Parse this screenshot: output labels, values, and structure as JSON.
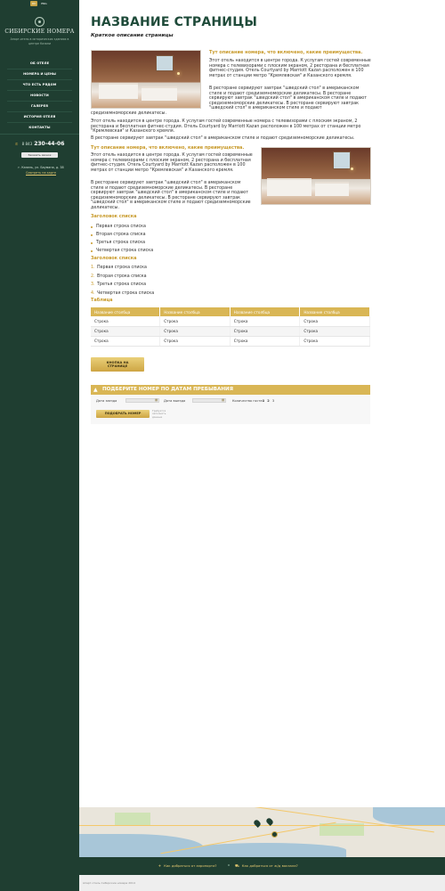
{
  "sidebar": {
    "lang": [
      "RU",
      "ENG"
    ],
    "logo_name": "СИБИРСКИЕ НОМЕРА",
    "logo_tagline": "Апарт-отель в исторических зданиях в центре Казани",
    "nav": [
      "ОБ ОТЕЛЕ",
      "НОМЕРА И ЦЕНЫ",
      "ЧТО ЕСТЬ РЯДОМ",
      "НОВОСТИ",
      "ГАЛЕРЕЯ",
      "ИСТОРИЯ ОТЕЛЯ",
      "КОНТАКТЫ"
    ],
    "phone_code": "8 843",
    "phone_number": "230-44-06",
    "callback": "Заказать звонок",
    "address": "г. Казань, ул. Баумана, д. 38",
    "map_link": "Смотреть на карте"
  },
  "main": {
    "title": "НАЗВАНИЕ СТРАНИЦЫ",
    "subtitle": "Краткое описание страницы",
    "lead1": "Тут описание номера, что включено, какие преимущества.",
    "p1": "Этот отель находится в центре города. К услугам гостей современные номера с телевизорами с плоским экраном, 2 ресторана и бесплатная фитнес-студия. Отель Courtyard by Marriott Kazan расположен в 100 метрах от станции метро \"Кремлевская\" и Казанского кремля.",
    "p2": "В ресторане сервируют завтрак \"шведский стол\" в американском стиле и подают средиземноморские деликатесы. В ресторане сервируют завтрак \"шведский стол\" в американском стиле и подают средиземноморские деликатесы. В ресторане сервируют завтрак \"шведский стол\" в американском стиле и подают",
    "p2_tail": "средиземноморские деликатесы.",
    "p3": "Этот отель находится в центре города. К услугам гостей современные номера с телевизорами с плоским экраном, 2 ресторана и бесплатная фитнес-студия. Отель Courtyard by Marriott Kazan расположен в 100 метрах от станции метро \"Кремлевская\" и Казанского кремля.",
    "p4": "В ресторане сервируют завтрак \"шведский стол\" в американском стиле и подают средиземноморские деликатесы.",
    "lead2": "Тут описание номера, что включено, какие преимущества.",
    "p5": "Этот отель находится в центре города. К услугам гостей современные номера с телевизорами с плоским экраном, 2 ресторана и бесплатная фитнес-студия. Отель Courtyard by Marriott Kazan расположен в 100 метрах от станции метро \"Кремлевская\" и Казанского кремля.",
    "p6": "В ресторане сервируют завтрак \"шведский стол\" в американском стиле и подают средиземноморские деликатесы. В ресторане сервируют завтрак \"шведский стол\" в американском стиле и подают средиземноморские деликатесы. В ресторане сервируют завтрак \"шведский стол\" в американском стиле и подают средиземноморские деликатесы.",
    "ul_head": "Заголовок списка",
    "ul": [
      "Первая строка списка",
      "Вторая строка списка",
      "Третья строка списка",
      "Четвертая строка списка"
    ],
    "ol_head": "Заголовок списка",
    "ol": [
      "Первая строка списка",
      "Вторая строка списка",
      "Третья строка списка",
      "Четвертая строка списка"
    ],
    "table_head": "Таблица",
    "table_cols": [
      "Название столбца",
      "Название столбца",
      "Название столбца",
      "Название столбца"
    ],
    "table_rows": [
      [
        "Строка",
        "Строка",
        "Строка",
        "Строка"
      ],
      [
        "Строка",
        "Строка",
        "Строка",
        "Строка"
      ],
      [
        "Строка",
        "Строка",
        "Строка",
        "Строка"
      ]
    ],
    "gold_btn_1": "КНОПКА НА",
    "gold_btn_2": "СТРАНИЦЕ"
  },
  "booking": {
    "title": "ПОДБЕРИТЕ НОМЕР ПО ДАТАМ ПРЕБЫВАНИЯ",
    "checkin_label": "Дата заезда",
    "checkout_label": "Дата выезда",
    "guests_label": "Количество гостей",
    "guests": [
      "1",
      "2",
      "3"
    ],
    "guests_selected": "2",
    "submit": "ПОДОБРАТЬ НОМЕР",
    "note": "Требуется заполнить данные"
  },
  "footer": {
    "airport_link": "Как добраться от аэропорта?",
    "rail_link": "Как добраться от ж/д вокзала?",
    "copyright": "Апарт-отель Сибирские номера 2014"
  },
  "colors": {
    "sidebar": "#1f3e31",
    "accent": "#d9b655",
    "title": "#1f4b3a"
  }
}
